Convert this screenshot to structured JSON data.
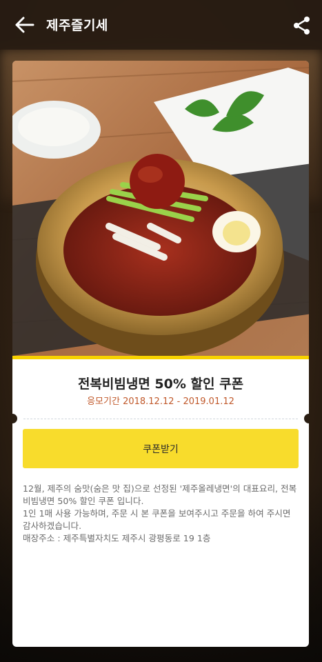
{
  "header": {
    "title": "제주즐기세",
    "back_icon": "arrow-left-icon",
    "share_icon": "share-icon"
  },
  "coupon": {
    "title": "전복비빔냉면 50% 할인 쿠폰",
    "period": "응모기간 2018.12.12 - 2019.01.12",
    "button_label": "쿠폰받기",
    "description": [
      "12월, 제주의 숨맛(숨은 맛 집)으로 선정된 '제주올레냉면'의 대표요리, 전복비빔냉면 50% 할인 쿠폰 입니다.",
      "1인 1매 사용 가능하며, 주문 시 본 쿠폰을 보여주시고 주문을 하여 주시면 감사하겠습니다.",
      "매장주소 : 제주특별자치도 제주시 광평동로 19 1층"
    ]
  },
  "colors": {
    "accent": "#f8dc2c",
    "period_text": "#c0582a",
    "header_bg": "#281c12"
  }
}
